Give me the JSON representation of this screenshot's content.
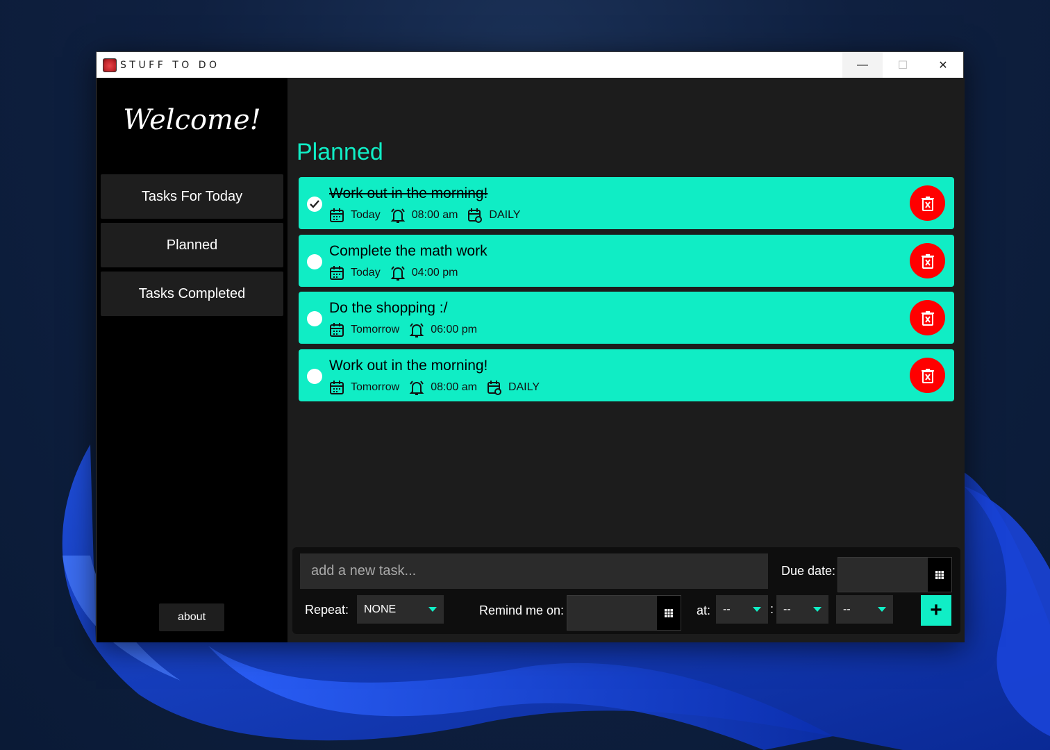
{
  "window": {
    "title": "STUFF TO DO",
    "minimize": "—",
    "maximize": "☐",
    "close": "✕"
  },
  "sidebar": {
    "welcome": "Welcome!",
    "items": [
      {
        "label": "Tasks For Today"
      },
      {
        "label": "Planned"
      },
      {
        "label": "Tasks Completed"
      }
    ],
    "about": "about"
  },
  "main": {
    "section_title": "Planned",
    "tasks": [
      {
        "title": "Work out in the morning!",
        "done": true,
        "date": "Today",
        "time": "08:00 am",
        "repeat": "DAILY"
      },
      {
        "title": "Complete the math work",
        "done": false,
        "date": "Today",
        "time": "04:00 pm",
        "repeat": ""
      },
      {
        "title": "Do the shopping :/",
        "done": false,
        "date": "Tomorrow",
        "time": "06:00 pm",
        "repeat": ""
      },
      {
        "title": "Work out in the morning!",
        "done": false,
        "date": "Tomorrow",
        "time": "08:00 am",
        "repeat": "DAILY"
      }
    ]
  },
  "form": {
    "placeholder": "add a new task...",
    "due_date_label": "Due date:",
    "repeat_label": "Repeat:",
    "repeat_value": "NONE",
    "remind_label": "Remind me on:",
    "at_label": "at:",
    "hour": "--",
    "minute": "--",
    "ampm": "--",
    "colon": ":",
    "add": "+"
  },
  "colors": {
    "accent": "#10edc5",
    "delete": "#ff0000",
    "sidebar": "#000000",
    "panel": "#1c1c1c"
  }
}
